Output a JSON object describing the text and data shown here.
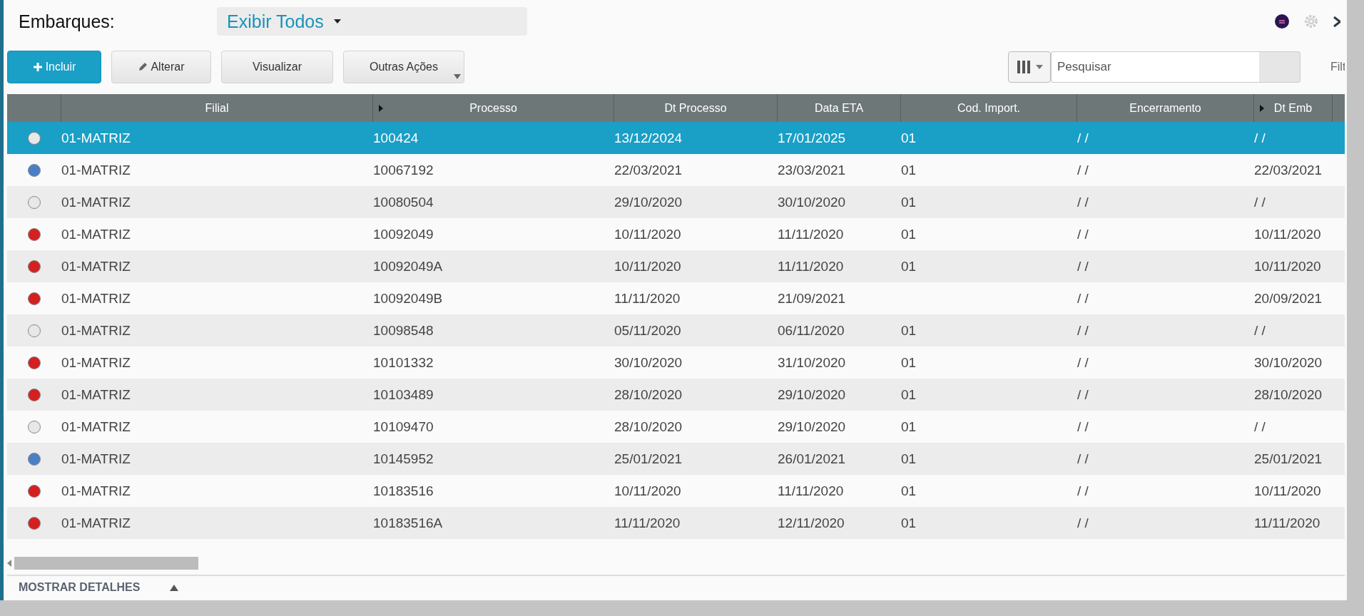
{
  "title": "Embarques:",
  "view_select": {
    "value": "Exibir Todos"
  },
  "actions": [
    {
      "label": "Incluir",
      "kind": "primary"
    },
    {
      "label": "Alterar",
      "kind": "edit"
    },
    {
      "label": "Visualizar",
      "kind": "plain"
    },
    {
      "label": "Outras Ações",
      "kind": "menu"
    }
  ],
  "search": {
    "placeholder": "Pesquisar"
  },
  "filter_label": "Filt",
  "table": {
    "columns": [
      {
        "label": "Filial",
        "marker": false
      },
      {
        "label": "Processo",
        "marker": true
      },
      {
        "label": "Dt Processo",
        "marker": false
      },
      {
        "label": "Data ETA",
        "marker": false
      },
      {
        "label": "Cod. Import.",
        "marker": false
      },
      {
        "label": "Encerramento",
        "marker": false
      },
      {
        "label": "Dt Emb",
        "marker": true
      }
    ],
    "rows": [
      {
        "color": "#e8e8e8",
        "selected": true,
        "cells": [
          "01-MATRIZ",
          "100424",
          "13/12/2024",
          "17/01/2025",
          "01",
          "/ /",
          "/ /"
        ]
      },
      {
        "color": "#4a7fc8",
        "selected": false,
        "cells": [
          "01-MATRIZ",
          "10067192",
          "22/03/2021",
          "23/03/2021",
          "01",
          "/ /",
          "22/03/2021"
        ]
      },
      {
        "color": "#e8e8e8",
        "selected": false,
        "cells": [
          "01-MATRIZ",
          "10080504",
          "29/10/2020",
          "30/10/2020",
          "01",
          "/ /",
          "/ /"
        ]
      },
      {
        "color": "#d42020",
        "selected": false,
        "cells": [
          "01-MATRIZ",
          "10092049",
          "10/11/2020",
          "11/11/2020",
          "01",
          "/ /",
          "10/11/2020"
        ]
      },
      {
        "color": "#d42020",
        "selected": false,
        "cells": [
          "01-MATRIZ",
          "10092049A",
          "10/11/2020",
          "11/11/2020",
          "01",
          "/ /",
          "10/11/2020"
        ]
      },
      {
        "color": "#d42020",
        "selected": false,
        "cells": [
          "01-MATRIZ",
          "10092049B",
          "11/11/2020",
          "21/09/2021",
          "",
          "/ /",
          "20/09/2021"
        ]
      },
      {
        "color": "#e8e8e8",
        "selected": false,
        "cells": [
          "01-MATRIZ",
          "10098548",
          "05/11/2020",
          "06/11/2020",
          "01",
          "/ /",
          "/ /"
        ]
      },
      {
        "color": "#d42020",
        "selected": false,
        "cells": [
          "01-MATRIZ",
          "10101332",
          "30/10/2020",
          "31/10/2020",
          "01",
          "/ /",
          "30/10/2020"
        ]
      },
      {
        "color": "#d42020",
        "selected": false,
        "cells": [
          "01-MATRIZ",
          "10103489",
          "28/10/2020",
          "29/10/2020",
          "01",
          "/ /",
          "28/10/2020"
        ]
      },
      {
        "color": "#e8e8e8",
        "selected": false,
        "cells": [
          "01-MATRIZ",
          "10109470",
          "28/10/2020",
          "29/10/2020",
          "01",
          "/ /",
          "/ /"
        ]
      },
      {
        "color": "#4a7fc8",
        "selected": false,
        "cells": [
          "01-MATRIZ",
          "10145952",
          "25/01/2021",
          "26/01/2021",
          "01",
          "/ /",
          "25/01/2021"
        ]
      },
      {
        "color": "#d42020",
        "selected": false,
        "cells": [
          "01-MATRIZ",
          "10183516",
          "10/11/2020",
          "11/11/2020",
          "01",
          "/ /",
          "10/11/2020"
        ]
      },
      {
        "color": "#d42020",
        "selected": false,
        "cells": [
          "01-MATRIZ",
          "10183516A",
          "11/11/2020",
          "12/11/2020",
          "01",
          "/ /",
          "11/11/2020"
        ]
      }
    ]
  },
  "details_toggle": "MOSTRAR DETALHES"
}
